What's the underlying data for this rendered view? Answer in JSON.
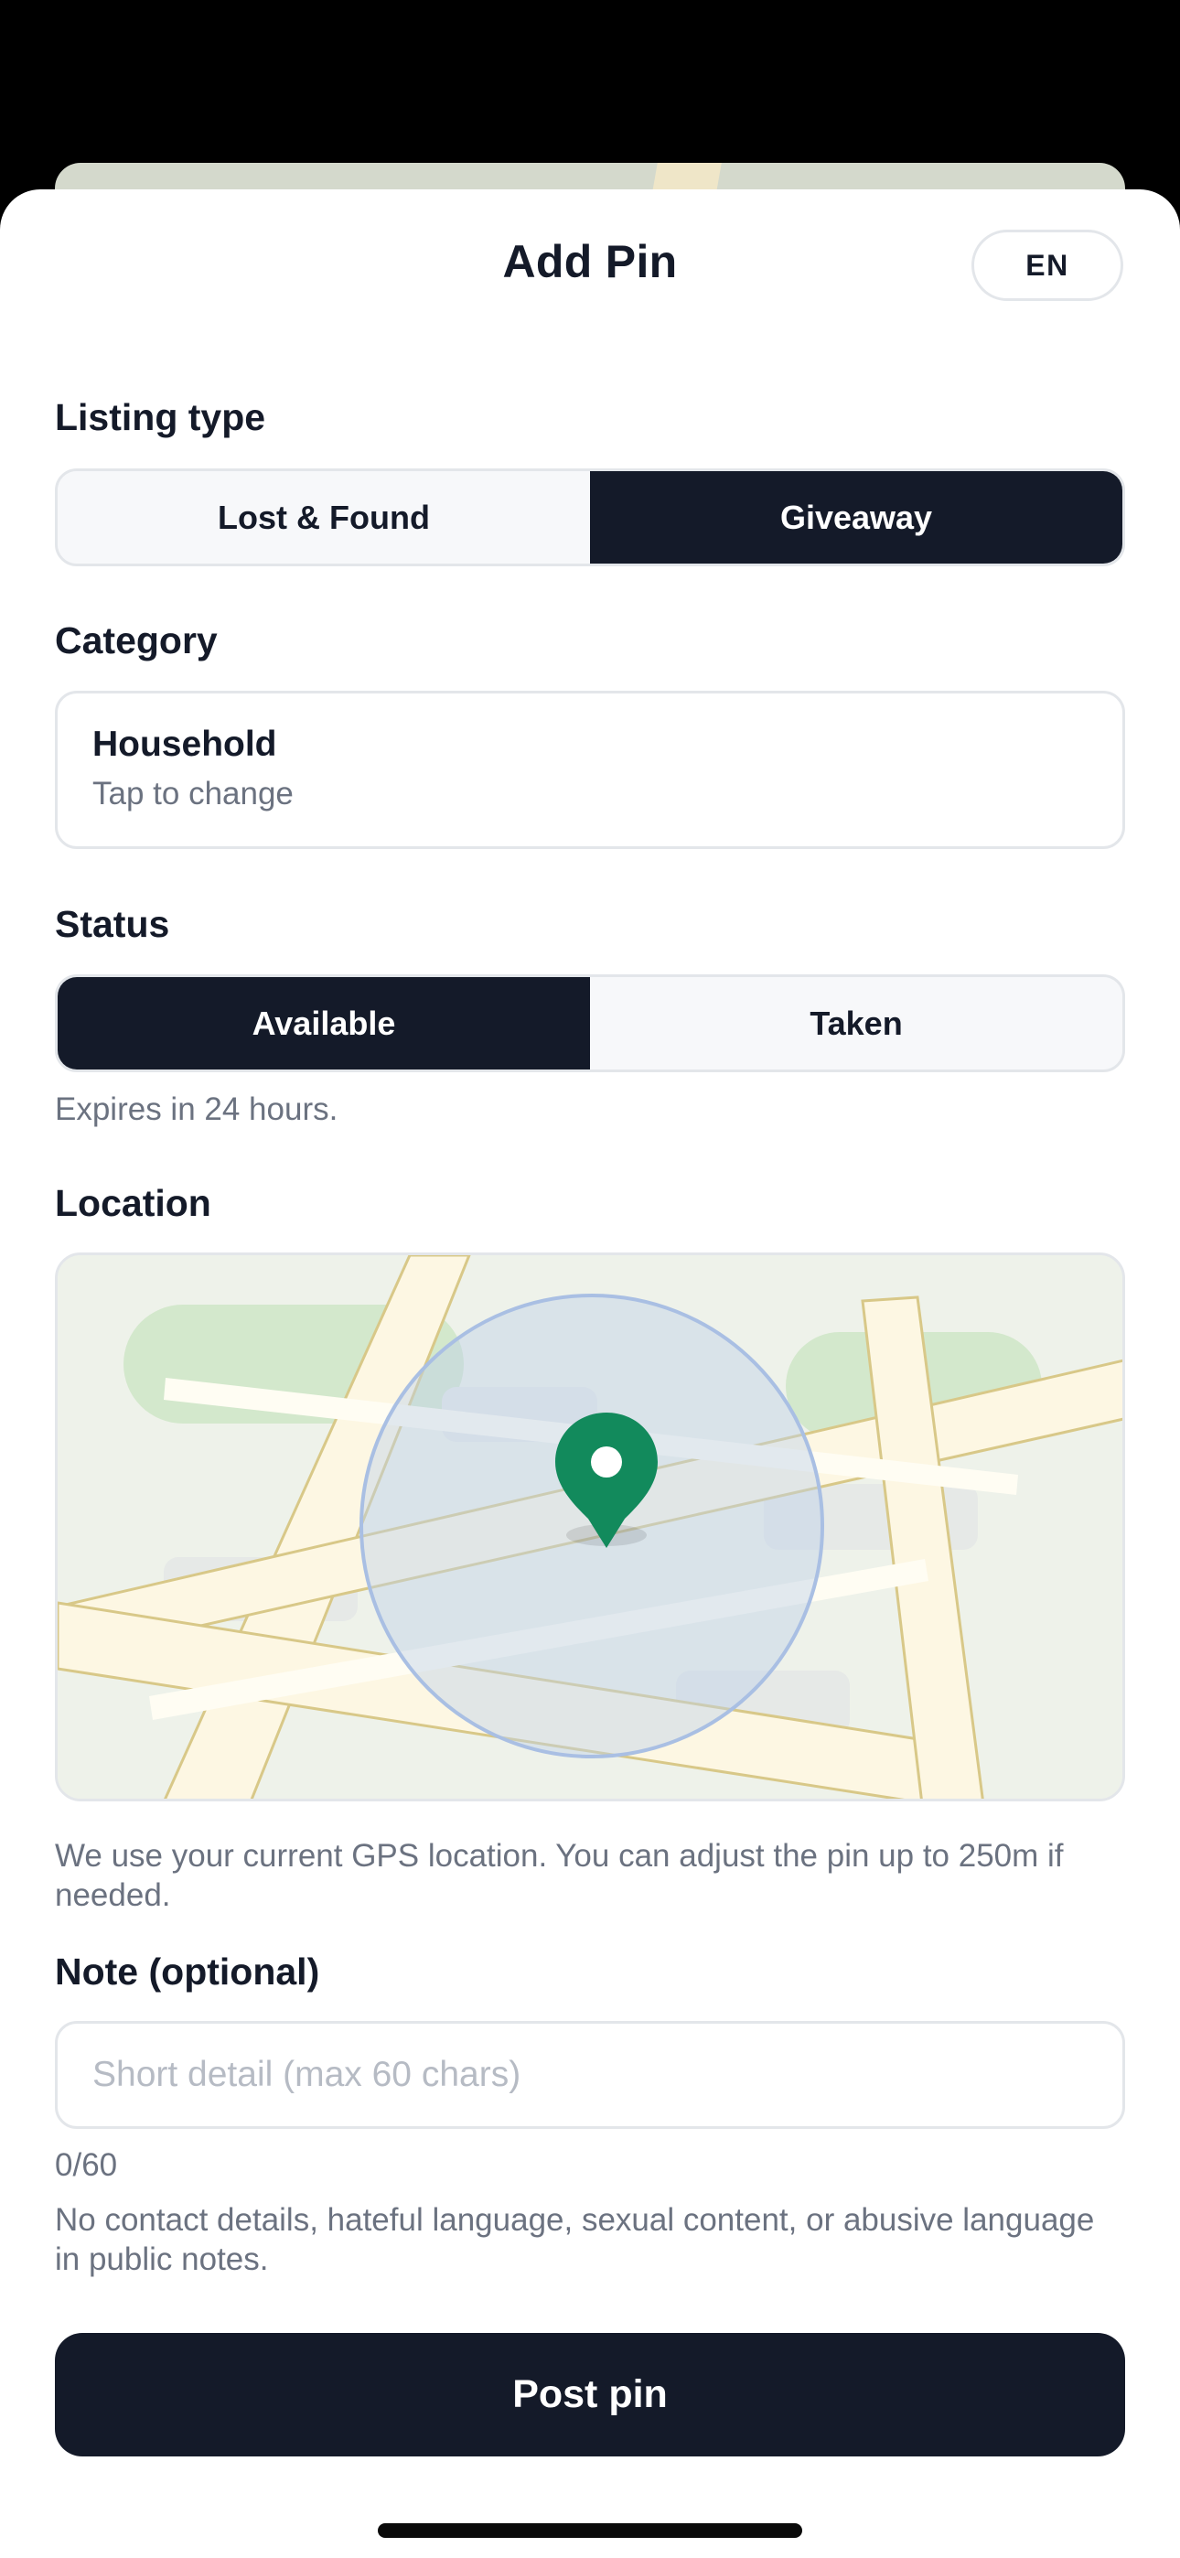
{
  "sheet": {
    "title": "Add Pin",
    "language_label": "EN"
  },
  "listing_type": {
    "label": "Listing type",
    "options": [
      "Lost & Found",
      "Giveaway"
    ],
    "selected": "Giveaway"
  },
  "category": {
    "label": "Category",
    "value": "Household",
    "hint": "Tap to change"
  },
  "status": {
    "label": "Status",
    "options": [
      "Available",
      "Taken"
    ],
    "selected": "Available",
    "expiry_text": "Expires in 24 hours."
  },
  "location": {
    "label": "Location",
    "map_icon": "location-pin-icon",
    "pin_color": "#128a5c",
    "radius_color": "#a9bfe3",
    "help_text": "We use your current GPS location. You can adjust the pin up to 250m if needed."
  },
  "note": {
    "label": "Note (optional)",
    "value": "",
    "placeholder": "Short detail (max 60 chars)",
    "counter": "0/60",
    "policy_text": "No contact details, hateful language, sexual content, or abusive language in public notes."
  },
  "actions": {
    "post_label": "Post pin"
  },
  "colors": {
    "primary": "#141a29",
    "muted_text": "#6b7280",
    "border": "#e3e6ea"
  }
}
